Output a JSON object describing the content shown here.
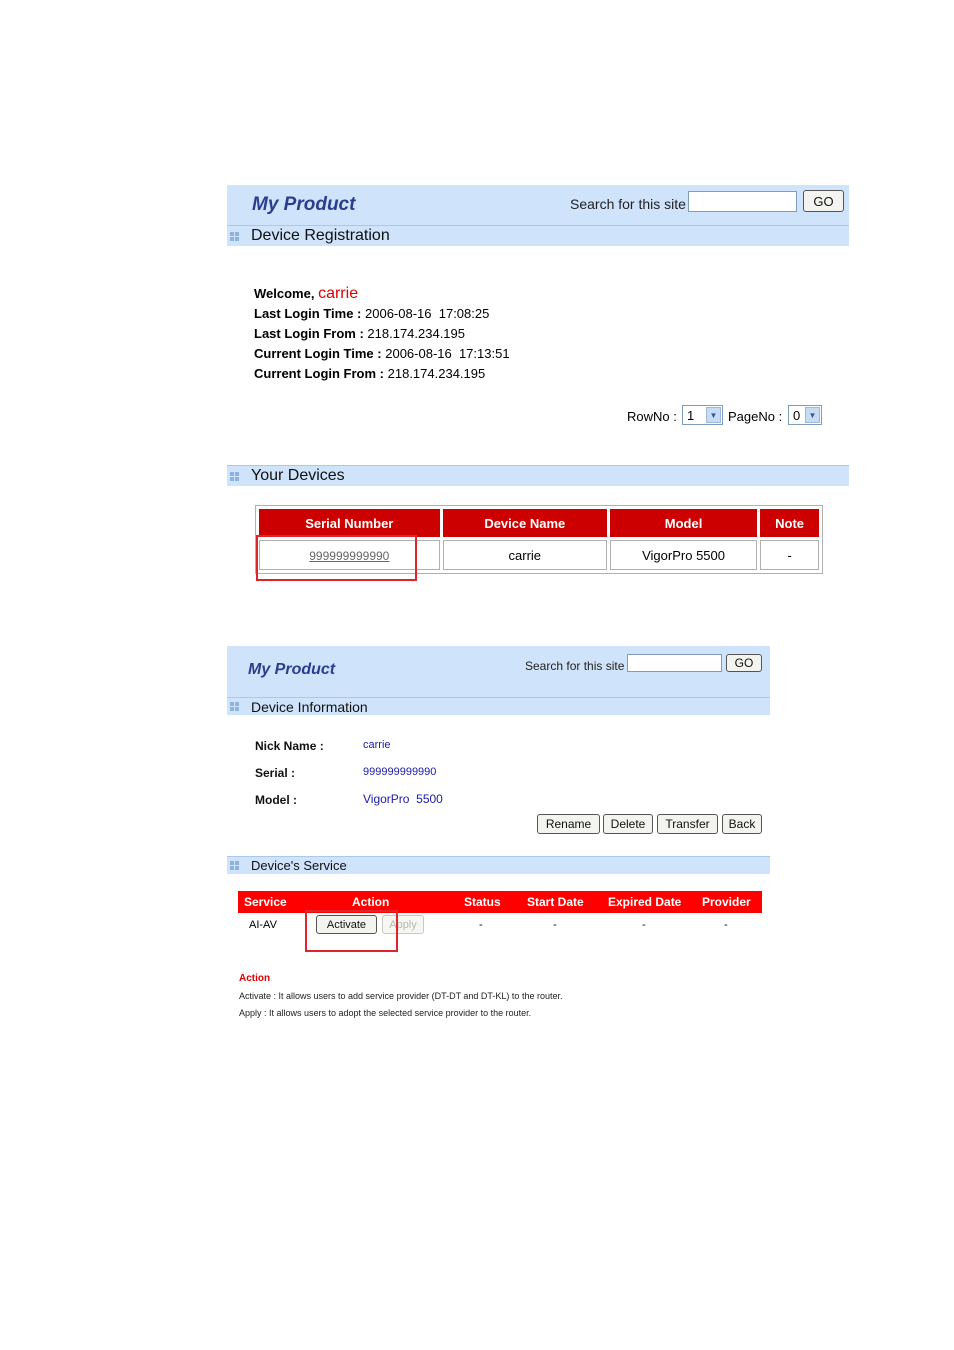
{
  "panel1": {
    "title": "My Product",
    "search_label": "Search for this site",
    "search_value": "",
    "go_label": "GO",
    "section_title": "Device Registration",
    "welcome_prefix": "Welcome,",
    "username": "carrie",
    "login_info": [
      {
        "label": "Last Login Time :",
        "value": "2006-08-16  17:08:25"
      },
      {
        "label": "Last Login From :",
        "value": "218.174.234.195"
      },
      {
        "label": "Current Login Time :",
        "value": "2006-08-16  17:13:51"
      },
      {
        "label": "Current Login From :",
        "value": "218.174.234.195"
      }
    ],
    "rowno_label": "RowNo :",
    "rowno_value": "1",
    "pageno_label": "PageNo :",
    "pageno_value": "0",
    "devices_title": "Your Devices",
    "table_headers": [
      "Serial Number",
      "Device Name",
      "Model",
      "Note"
    ],
    "table_rows": [
      {
        "serial": "999999999990",
        "name": "carrie",
        "model": "VigorPro 5500",
        "note": "-"
      }
    ]
  },
  "panel2": {
    "title": "My Product",
    "search_label": "Search for this site",
    "search_value": "",
    "go_label": "GO",
    "section_title": "Device Information",
    "fields": [
      {
        "label": "Nick Name :",
        "value": "carrie"
      },
      {
        "label": "Serial :",
        "value": "999999999990"
      },
      {
        "label": "Model :",
        "value": "VigorPro  5500"
      }
    ],
    "buttons": {
      "rename": "Rename",
      "delete": "Delete",
      "transfer": "Transfer",
      "back": "Back"
    },
    "service_title": "Device's Service",
    "service_headers": [
      "Service",
      "Action",
      "Status",
      "Start Date",
      "Expired Date",
      "Provider"
    ],
    "service_row": {
      "service": "AI-AV",
      "activate": "Activate",
      "apply": "Apply",
      "status": "-",
      "start": "-",
      "expired": "-",
      "provider": "-"
    },
    "action_title": "Action",
    "action_notes": [
      "Activate : It allows users to add service provider (DT-DT and DT-KL) to the router.",
      "Apply : It allows users to adopt the selected service provider to the router."
    ]
  },
  "colors": {
    "header_band": "#cfe3fb",
    "table_header_red": "#cc0000",
    "service_header_red": "#ff0000",
    "title_blue": "#2b3d8f",
    "highlight_red": "#e0242b"
  }
}
